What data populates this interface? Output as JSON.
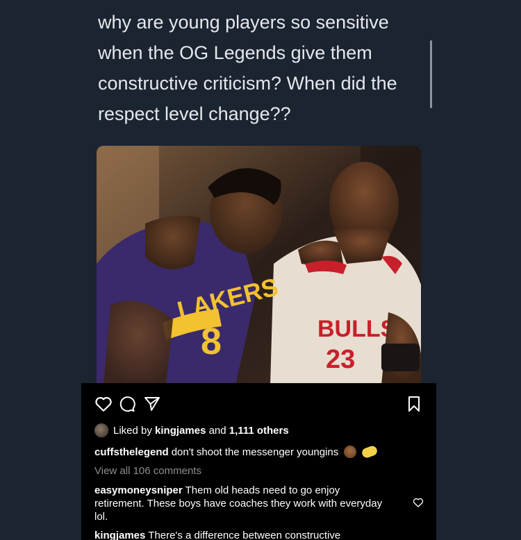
{
  "tweet": {
    "text": "why are young players so sensitive when the OG Legends give them constructive criticism? When did the respect level change??"
  },
  "post": {
    "jersey_left": {
      "team": "LAKERS",
      "number": "8"
    },
    "jersey_right": {
      "team": "BULLS",
      "number": "23"
    },
    "icons": {
      "like": "heart-icon",
      "comment": "comment-icon",
      "share": "send-icon",
      "save": "bookmark-icon"
    },
    "likes": {
      "prefix": "Liked by",
      "user": "kingjames",
      "middle": "and",
      "others": "1,111 others"
    },
    "caption": {
      "user": "cuffsthelegend",
      "text": "don't shoot the messenger youngins"
    },
    "view_all": "View all 106 comments",
    "comments": [
      {
        "user": "easymoneysniper",
        "text": "Them old heads need to go enjoy retirement. These boys have coaches they work with everyday lol."
      },
      {
        "user": "kingjames",
        "text": "There's a difference between constructive"
      }
    ]
  }
}
